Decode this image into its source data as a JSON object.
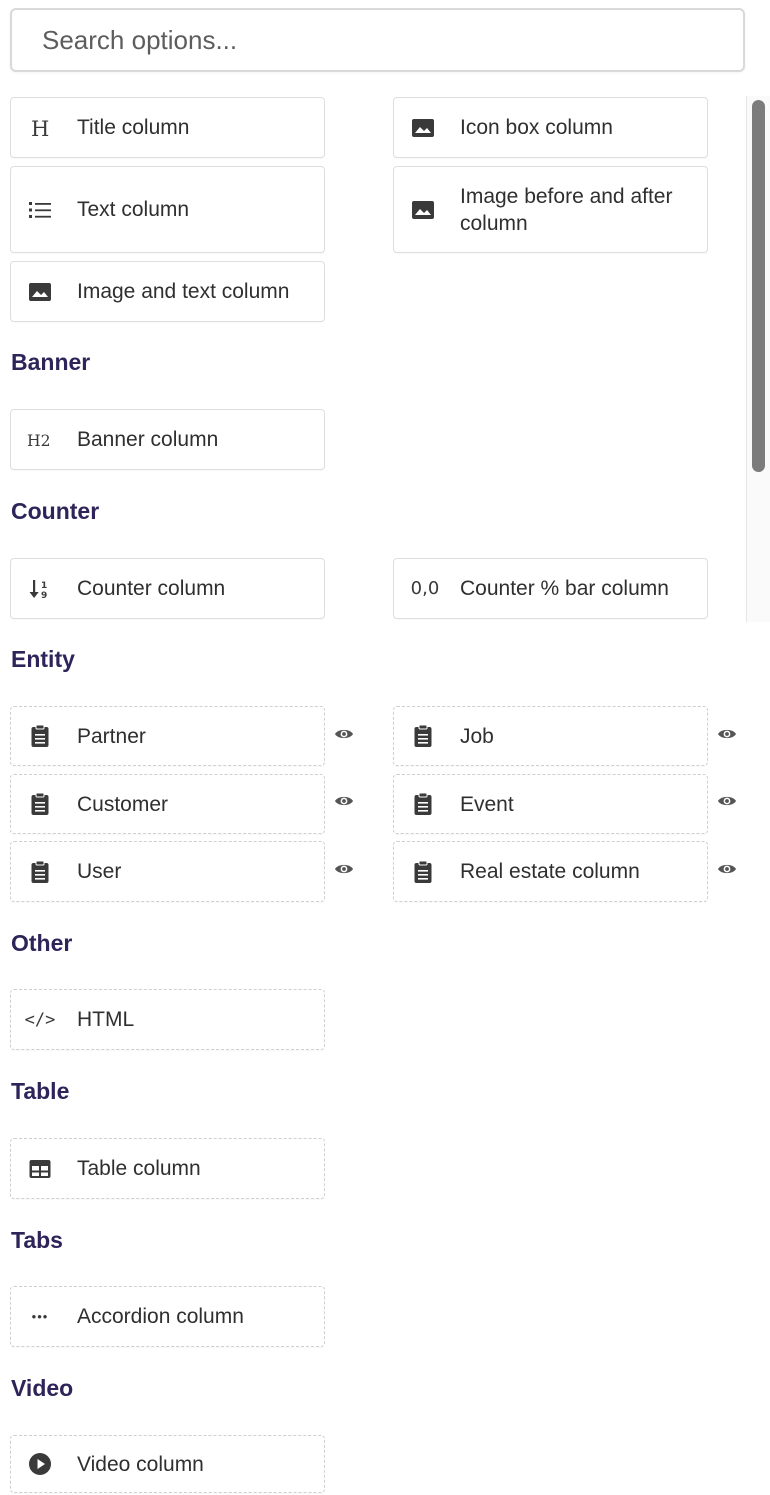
{
  "search": {
    "placeholder": "Search options...",
    "value": ""
  },
  "general": {
    "items": [
      {
        "label": "Title column",
        "icon": "heading-icon"
      },
      {
        "label": "Icon box column",
        "icon": "image-icon"
      },
      {
        "label": "Text column",
        "icon": "list-icon"
      },
      {
        "label": "Image before and after column",
        "icon": "image-icon"
      },
      {
        "label": "Image and text column",
        "icon": "image-icon"
      }
    ]
  },
  "banner": {
    "title": "Banner",
    "items": [
      {
        "label": "Banner column",
        "icon": "h2-heading-icon",
        "glyph": "H2"
      }
    ]
  },
  "counter": {
    "title": "Counter",
    "items": [
      {
        "label": "Counter column",
        "icon": "sort-numeric-icon"
      },
      {
        "label": "Counter % bar column",
        "icon": "decimal-icon",
        "glyph": "0,0"
      }
    ]
  },
  "entity": {
    "title": "Entity",
    "items": [
      {
        "label": "Partner",
        "icon": "clipboard-icon"
      },
      {
        "label": "Job",
        "icon": "clipboard-icon"
      },
      {
        "label": "Customer",
        "icon": "clipboard-icon"
      },
      {
        "label": "Event",
        "icon": "clipboard-icon"
      },
      {
        "label": "User",
        "icon": "clipboard-icon"
      },
      {
        "label": "Real estate column",
        "icon": "clipboard-icon"
      }
    ]
  },
  "other": {
    "title": "Other",
    "items": [
      {
        "label": "HTML",
        "icon": "code-icon",
        "glyph": "</>"
      }
    ]
  },
  "table": {
    "title": "Table",
    "items": [
      {
        "label": "Table column",
        "icon": "table-icon"
      }
    ]
  },
  "tabs": {
    "title": "Tabs",
    "items": [
      {
        "label": "Accordion column",
        "icon": "more-horizontal-icon",
        "glyph": "•••"
      }
    ]
  },
  "video": {
    "title": "Video",
    "items": [
      {
        "label": "Video column",
        "icon": "play-circle-icon"
      }
    ]
  },
  "colors": {
    "section_title": "#2e2459",
    "text": "#2f2f2f",
    "icon": "#3a3a3a",
    "border": "#dedede"
  }
}
